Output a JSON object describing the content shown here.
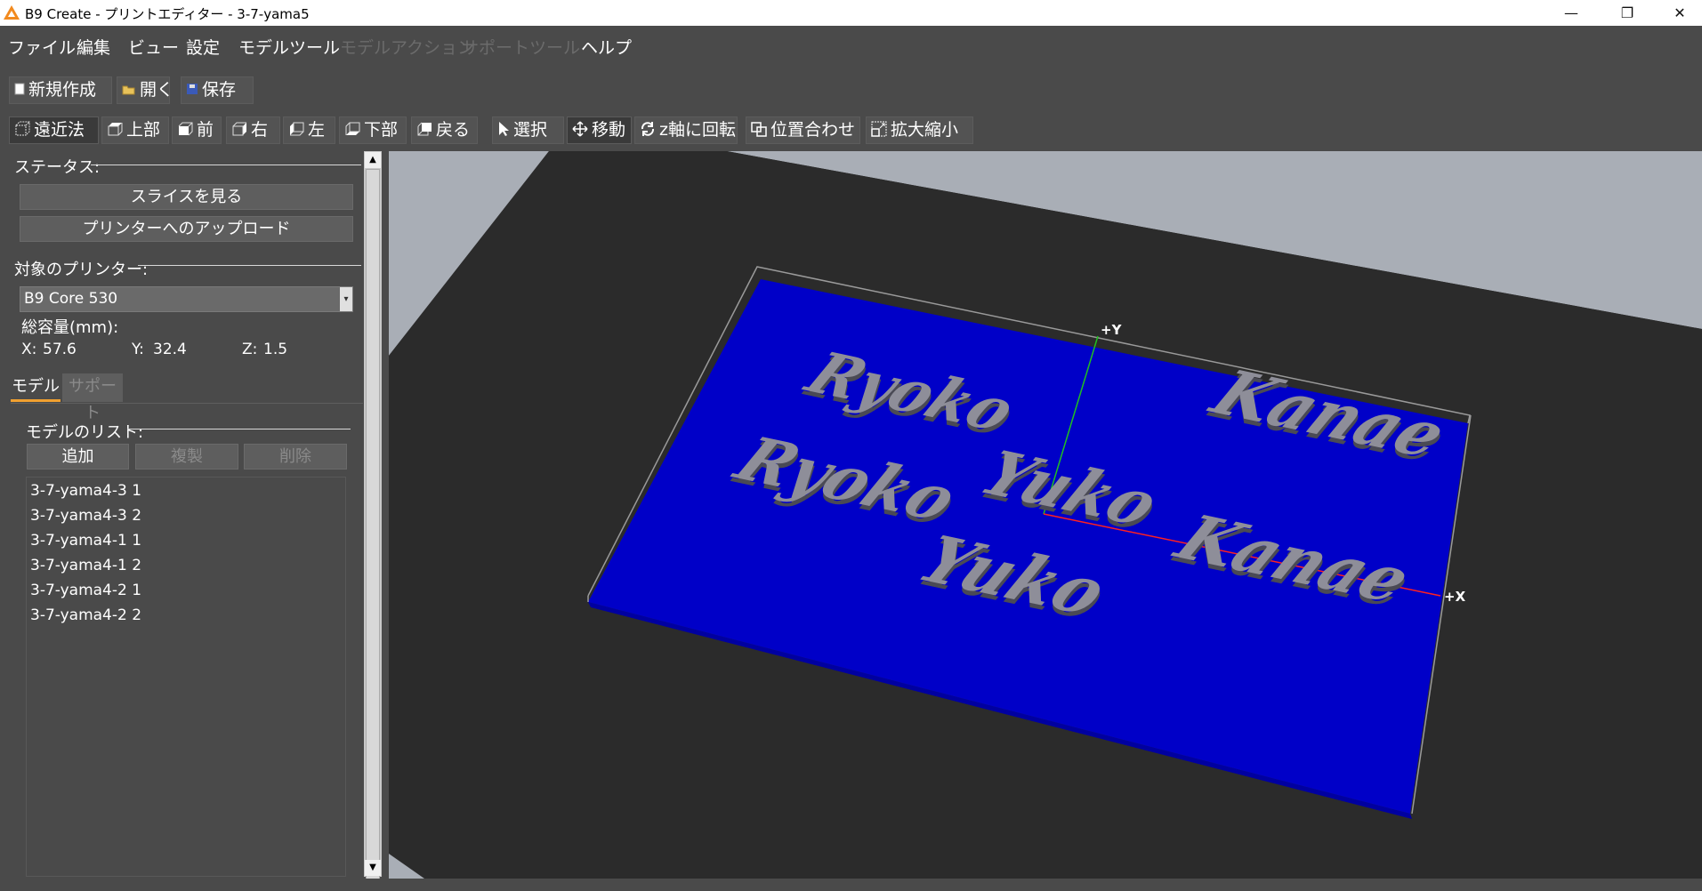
{
  "window": {
    "title": "B9 Create - プリントエディター - 3-7-yama5",
    "minimize_glyph": "—",
    "maximize_glyph": "❐",
    "close_glyph": "✕"
  },
  "menu": {
    "items": [
      {
        "label": "ファイル",
        "enabled": true
      },
      {
        "label": "編集",
        "enabled": true
      },
      {
        "label": "ビュー",
        "enabled": true
      },
      {
        "label": "設定",
        "enabled": true
      },
      {
        "label": "モデルツール",
        "enabled": true
      },
      {
        "label": "モデルアクション",
        "enabled": false
      },
      {
        "label": "サポートツール",
        "enabled": false
      },
      {
        "label": "ヘルプ",
        "enabled": true
      }
    ]
  },
  "file_toolbar": {
    "new_label": "新規作成",
    "open_label": "開く",
    "save_label": "保存"
  },
  "view_toolbar": {
    "perspective_label": "遠近法",
    "top_label": "上部",
    "front_label": "前",
    "right_label": "右",
    "left_label": "左",
    "bottom_label": "下部",
    "back_label": "戻る"
  },
  "tool_toolbar": {
    "select_label": "選択",
    "move_label": "移動",
    "rotate_label": "z軸に回転",
    "align_label": "位置合わせ",
    "scale_label": "拡大縮小"
  },
  "panel": {
    "status_label": "ステータス:",
    "view_slices_button": "スライスを見る",
    "upload_button": "プリンターへのアップロード",
    "target_printer_label": "対象のプリンター:",
    "printer_selected": "B9 Core 530",
    "volume_label": "総容量(mm):",
    "volume_x_label": "X:",
    "volume_x": "57.6",
    "volume_y_label": "Y:",
    "volume_y": "32.4",
    "volume_z_label": "Z:",
    "volume_z": "1.5",
    "tabs": {
      "model": "モデル",
      "support": "サポート"
    },
    "model_list_label": "モデルのリスト:",
    "add_button": "追加",
    "duplicate_button": "複製",
    "delete_button": "削除",
    "models": [
      "3-7-yama4-3 1",
      "3-7-yama4-3 2",
      "3-7-yama4-1 1",
      "3-7-yama4-1 2",
      "3-7-yama4-2 1",
      "3-7-yama4-2 2"
    ]
  },
  "viewport": {
    "axis_y_label": "+Y",
    "axis_x_label": "+X",
    "models_text": [
      "Ryoko",
      "Kanae",
      "Ryoko",
      "Yuko",
      "Yuko",
      "Kanae"
    ],
    "colors": {
      "background": "#2b2b2b",
      "floor": "#3a3a3a",
      "sky": "#a9aeb6",
      "build_plate": "#0000c8",
      "model": "#8e8e99",
      "axis_x": "#ff2020",
      "axis_y": "#20c020"
    }
  }
}
